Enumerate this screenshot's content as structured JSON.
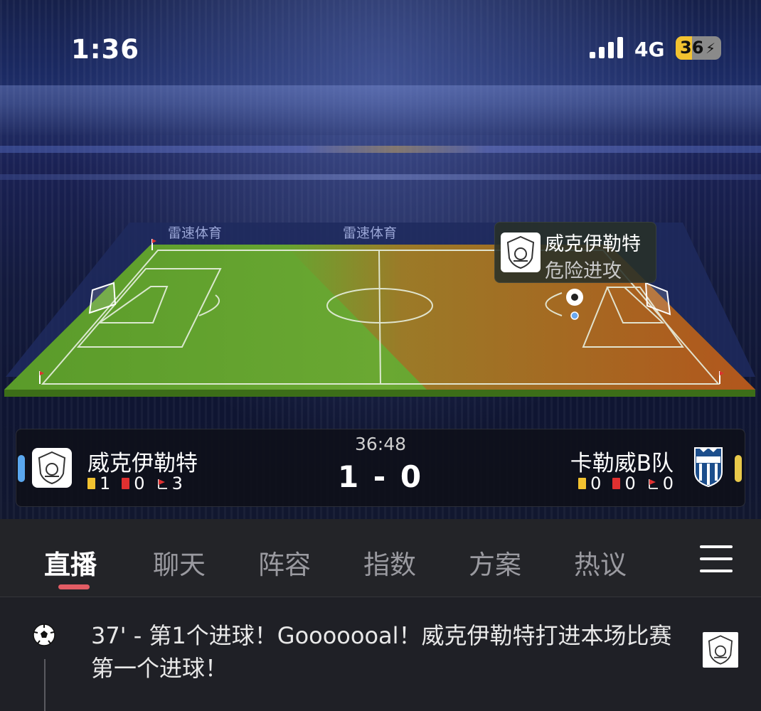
{
  "status_bar": {
    "time": "1:36",
    "network": "4G",
    "battery": "36"
  },
  "pitch": {
    "sponsor": "雷速体育",
    "attack_team": "威克伊勒特",
    "attack_status": "危险进攻",
    "colors": {
      "grass": "#5d9a2a",
      "danger_zone": "#c4551f"
    }
  },
  "match": {
    "clock": "36:48",
    "score": "1 - 0",
    "home": {
      "name": "威克伊勒特",
      "yellow": "1",
      "red": "0",
      "corners": "3",
      "color": "#5aa7ef"
    },
    "away": {
      "name": "卡勒威B队",
      "yellow": "0",
      "red": "0",
      "corners": "0",
      "color": "#e9c94a"
    }
  },
  "tabs": [
    {
      "label": "直播",
      "active": true
    },
    {
      "label": "聊天"
    },
    {
      "label": "阵容"
    },
    {
      "label": "指数"
    },
    {
      "label": "方案"
    },
    {
      "label": "热议"
    }
  ],
  "feed": {
    "events": [
      {
        "icon": "soccer-ball-icon",
        "text": "37' - 第1个进球！Gooooooal！威克伊勒特打进本场比赛第一个进球！"
      }
    ]
  },
  "accent_color": "#e25c64"
}
